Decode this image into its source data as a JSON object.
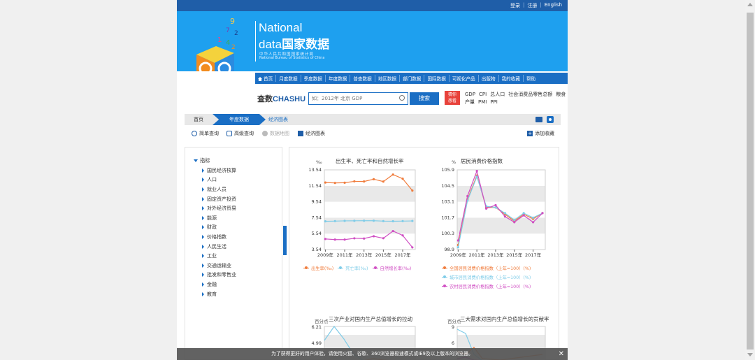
{
  "topbar": {
    "login": "登录",
    "sep": "|",
    "register": "注册",
    "english": "English"
  },
  "banner": {
    "title_en1": "National",
    "title_en2": "data",
    "title_cn": "国家数据",
    "org_cn": "中华人民共和国国家统计局",
    "org_en": "National Bureau of Statistics of China"
  },
  "nav": {
    "items": [
      "首页",
      "月度数据",
      "季度数据",
      "年度数据",
      "普查数据",
      "地区数据",
      "部门数据",
      "国际数据",
      "可视化产品",
      "出版物",
      "我的收藏",
      "帮助"
    ]
  },
  "search": {
    "logo_a": "查数",
    "logo_b": "CHASHU",
    "placeholder": "如：2012年 北京 GDP",
    "button": "搜索",
    "hot_label_1": "猜你",
    "hot_label_2": "想看",
    "quick_links": [
      "GDP",
      "CPI",
      "总人口",
      "社会消费品零售总额",
      "粮食产量",
      "PMI",
      "PPI"
    ]
  },
  "breadcrumb": {
    "home": "首页",
    "annual": "年度数据",
    "current": "经济图表"
  },
  "toolbar": {
    "simple": "简单查询",
    "advanced": "高级查询",
    "map": "数据地图",
    "chart": "经济图表",
    "add_favorite": "添加收藏"
  },
  "tree": {
    "root": "指标",
    "items": [
      "国民经济核算",
      "人口",
      "就业人员",
      "固定资产投资",
      "对外经济贸易",
      "能源",
      "财政",
      "价格指数",
      "人民生活",
      "工业",
      "交通运输业",
      "批发和零售业",
      "金融",
      "教育"
    ]
  },
  "notice": {
    "text": "为了获得更好的用户体验，请使用火狐、谷歌、360浏览器极速模式或IE9及以上版本的浏览器。",
    "close": "✕"
  },
  "chart_data": [
    {
      "type": "line",
      "title": "出生率、死亡率和自然增长率",
      "ylabel": "‰",
      "x": [
        "2009年",
        "2011年",
        "2013年",
        "2015年",
        "2017年"
      ],
      "x_values": [
        2009,
        2010,
        2011,
        2012,
        2013,
        2014,
        2015,
        2016,
        2017,
        2018
      ],
      "yticks": [
        3.54,
        5.54,
        7.54,
        9.54,
        11.54,
        13.54
      ],
      "ylim": [
        3.54,
        13.54
      ],
      "series": [
        {
          "name": "出生率(‰)",
          "color": "#f07c3c",
          "values": [
            11.95,
            11.9,
            11.93,
            12.1,
            12.08,
            12.37,
            12.07,
            12.95,
            12.43,
            10.94
          ]
        },
        {
          "name": "死亡率(‰)",
          "color": "#7fcce8",
          "values": [
            7.08,
            7.11,
            7.14,
            7.15,
            7.16,
            7.16,
            7.11,
            7.09,
            7.11,
            7.13
          ]
        },
        {
          "name": "自然增长率(‰)",
          "color": "#d04fc3",
          "values": [
            4.87,
            4.79,
            4.79,
            4.95,
            4.92,
            5.21,
            4.96,
            5.86,
            5.32,
            3.81
          ]
        }
      ]
    },
    {
      "type": "line",
      "title": "居民消费价格指数",
      "ylabel": "%",
      "x": [
        "2009年",
        "2011年",
        "2013年",
        "2015年",
        "2017年"
      ],
      "x_values": [
        2009,
        2010,
        2011,
        2012,
        2013,
        2014,
        2015,
        2016,
        2017,
        2018
      ],
      "yticks": [
        98.9,
        100.3,
        101.7,
        103.1,
        104.5,
        105.9
      ],
      "ylim": [
        98.9,
        105.9
      ],
      "series": [
        {
          "name": "全国居民消费价格指数（上年=100）(%)",
          "color": "#f07c3c",
          "values": [
            99.3,
            103.3,
            105.4,
            102.6,
            102.6,
            102.0,
            101.4,
            102.0,
            101.6,
            102.1
          ]
        },
        {
          "name": "城市居民消费价格指数（上年=100）(%)",
          "color": "#7fcce8",
          "values": [
            99.1,
            103.2,
            105.3,
            102.7,
            102.6,
            102.1,
            101.5,
            102.1,
            101.7,
            102.1
          ]
        },
        {
          "name": "农村居民消费价格指数（上年=100）(%)",
          "color": "#d04fc3",
          "values": [
            99.7,
            103.6,
            105.8,
            102.5,
            102.8,
            101.8,
            101.3,
            101.9,
            101.3,
            102.1
          ]
        }
      ]
    },
    {
      "type": "line",
      "title": "三次产业对国内生产总值增长的拉动",
      "ylabel": "百分点",
      "yticks": [
        4.99,
        6.21
      ],
      "series": []
    },
    {
      "type": "line",
      "title": "三大需求对国内生产总值增长的贡献率",
      "ylabel": "百分点",
      "yticks": [
        6,
        9
      ],
      "series": []
    }
  ]
}
